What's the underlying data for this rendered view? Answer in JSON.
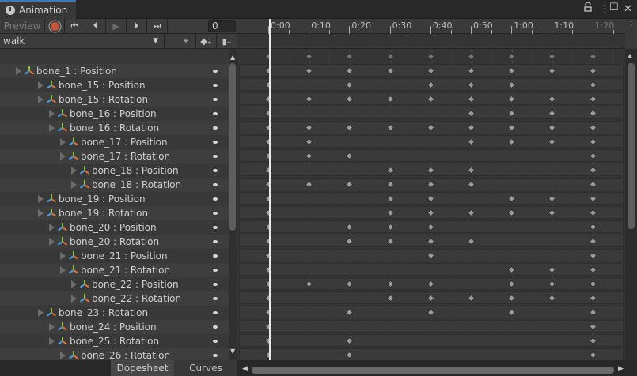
{
  "window": {
    "tab_title": "Animation",
    "lock": "lock-icon",
    "menu": "⋮",
    "maximize": "☐",
    "close": "✕"
  },
  "toolbar": {
    "preview_label": "Preview",
    "frame_value": "0",
    "clip_name": "walk"
  },
  "ruler": {
    "labels": [
      "0:00",
      "0:10",
      "0:20",
      "0:30",
      "0:40",
      "0:50",
      "1:00",
      "1:10",
      "1:20"
    ]
  },
  "tracks": [
    {
      "label": "bone_1 : Position",
      "depth": 0,
      "keys": [
        0,
        1,
        2,
        3,
        4,
        5,
        6,
        7,
        8
      ]
    },
    {
      "label": "bone_15 : Position",
      "depth": 1,
      "keys": [
        0,
        2,
        4,
        5,
        6,
        8
      ]
    },
    {
      "label": "bone_15 : Rotation",
      "depth": 1,
      "keys": [
        0,
        1,
        2,
        3,
        4,
        5,
        6,
        7,
        8
      ]
    },
    {
      "label": "bone_16 : Position",
      "depth": 2,
      "keys": [
        0,
        5,
        6,
        7,
        8
      ]
    },
    {
      "label": "bone_16 : Rotation",
      "depth": 2,
      "keys": [
        0,
        1,
        2,
        3,
        4,
        5,
        6,
        7,
        8
      ]
    },
    {
      "label": "bone_17 : Position",
      "depth": 3,
      "keys": [
        0,
        1,
        5,
        6,
        7,
        8
      ]
    },
    {
      "label": "bone_17 : Rotation",
      "depth": 3,
      "keys": [
        0,
        1,
        2,
        8
      ]
    },
    {
      "label": "bone_18 : Position",
      "depth": 4,
      "keys": [
        0,
        3,
        4,
        5,
        8
      ]
    },
    {
      "label": "bone_18 : Rotation",
      "depth": 4,
      "keys": [
        0,
        1,
        2,
        3,
        4,
        5,
        8
      ]
    },
    {
      "label": "bone_19 : Position",
      "depth": 1,
      "keys": [
        0,
        3,
        4,
        6,
        7,
        8
      ]
    },
    {
      "label": "bone_19 : Rotation",
      "depth": 1,
      "keys": [
        0,
        3,
        4,
        5,
        6,
        7,
        8
      ]
    },
    {
      "label": "bone_20 : Position",
      "depth": 2,
      "keys": [
        0,
        2,
        3,
        4,
        8
      ]
    },
    {
      "label": "bone_20 : Rotation",
      "depth": 2,
      "keys": [
        0,
        2,
        3,
        4,
        5,
        8
      ]
    },
    {
      "label": "bone_21 : Position",
      "depth": 3,
      "keys": [
        0,
        4,
        8
      ]
    },
    {
      "label": "bone_21 : Rotation",
      "depth": 3,
      "keys": [
        0,
        6,
        7,
        8
      ]
    },
    {
      "label": "bone_22 : Position",
      "depth": 4,
      "keys": [
        0,
        1,
        2,
        3,
        4,
        6,
        7,
        8
      ]
    },
    {
      "label": "bone_22 : Rotation",
      "depth": 4,
      "keys": [
        0,
        3,
        4,
        5,
        6,
        7,
        8
      ]
    },
    {
      "label": "bone_23 : Rotation",
      "depth": 1,
      "keys": [
        0,
        2,
        4,
        6,
        8
      ]
    },
    {
      "label": "bone_24 : Position",
      "depth": 2,
      "keys": [
        0,
        8
      ]
    },
    {
      "label": "bone_25 : Rotation",
      "depth": 2,
      "keys": [
        0,
        2,
        8
      ]
    },
    {
      "label": "bone_26 : Rotation",
      "depth": 3,
      "keys": [
        0,
        2,
        8
      ]
    }
  ],
  "summary_keys": [
    0,
    1,
    2,
    3,
    4,
    5,
    6,
    7,
    8
  ],
  "bottom_tabs": {
    "dopesheet": "Dopesheet",
    "curves": "Curves"
  },
  "colors": {
    "accent": "#3a79bb",
    "record": "#c0543a"
  }
}
